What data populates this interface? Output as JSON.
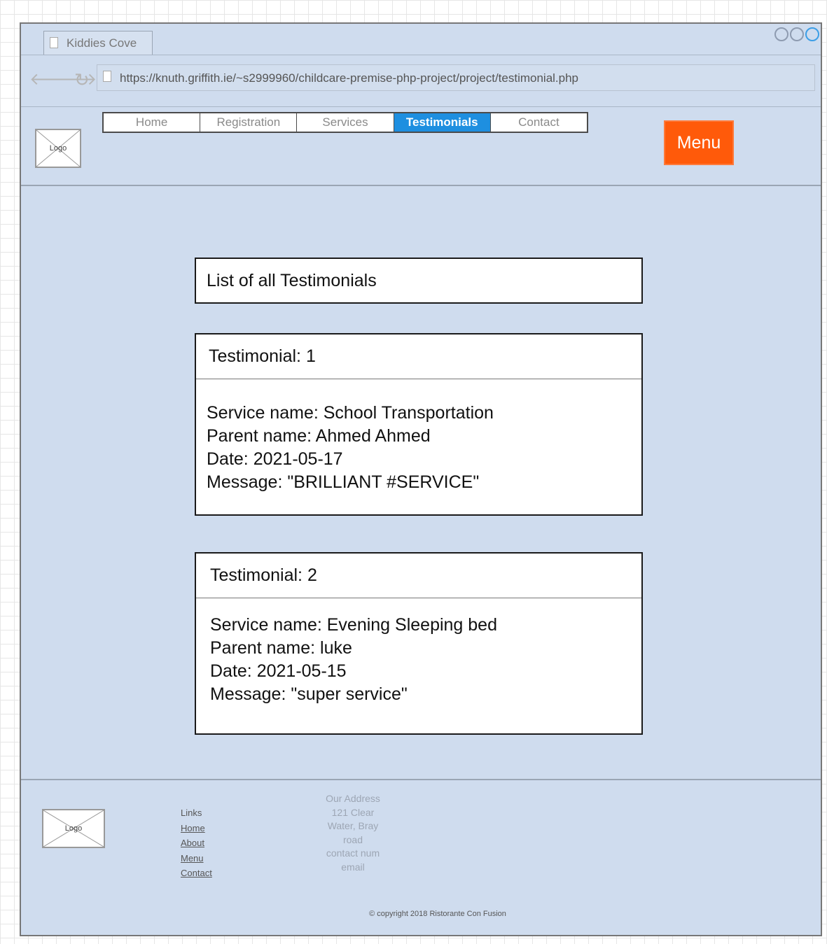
{
  "window": {
    "tab_title": "Kiddies Cove",
    "url": "https://knuth.griffith.ie/~s2999960/childcare-premise-php-project/project/testimonial.php"
  },
  "header": {
    "logo_text": "Logo",
    "nav": [
      {
        "label": "Home",
        "active": false
      },
      {
        "label": "Registration",
        "active": false
      },
      {
        "label": "Services",
        "active": false
      },
      {
        "label": "Testimonials",
        "active": true
      },
      {
        "label": "Contact",
        "active": false
      }
    ],
    "menu_button": "Menu"
  },
  "main": {
    "list_title": "List of all Testimonials",
    "testimonials": [
      {
        "heading": "Testimonial: 1",
        "service": "Service name: School Transportation",
        "parent": "Parent name: Ahmed Ahmed",
        "date": "Date: 2021-05-17",
        "message": "Message: \"BRILLIANT #SERVICE\""
      },
      {
        "heading": "Testimonial: 2",
        "service": "Service name: Evening Sleeping bed",
        "parent": "Parent name: luke",
        "date": "Date: 2021-05-15",
        "message": "Message: \"super service\""
      }
    ]
  },
  "footer": {
    "logo_text": "Logo",
    "links_heading": "Links",
    "links": [
      "Home",
      "About",
      "Menu",
      "Contact"
    ],
    "address": [
      "Our Address",
      "121 Clear",
      "Water, Bray",
      "road",
      "contact num",
      "email"
    ],
    "copyright": "© copyright 2018 Ristorante Con Fusion"
  },
  "colors": {
    "page_background": "#cfdcee",
    "active_nav": "#1e8fe0",
    "menu_button": "#ff5a0a"
  }
}
